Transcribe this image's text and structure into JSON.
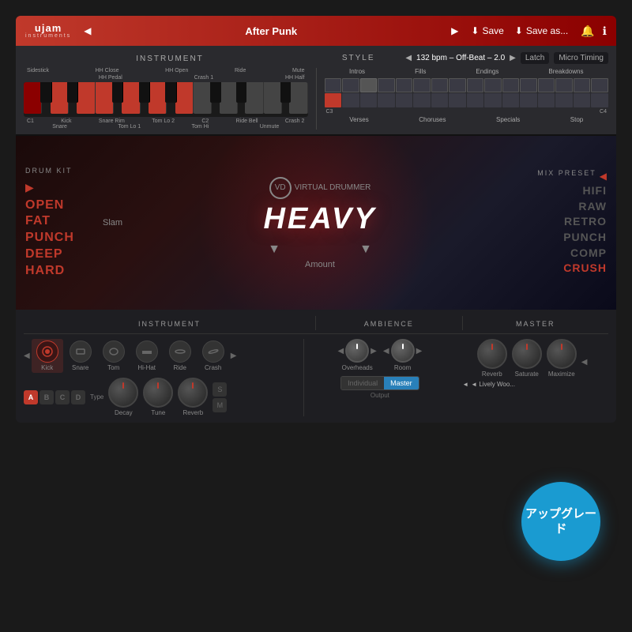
{
  "app": {
    "logo": "ujam",
    "logo_sub": "instruments",
    "preset_name": "After Punk",
    "save_label": "Save",
    "save_as_label": "Save as..."
  },
  "style_bar": {
    "bpm_info": "132 bpm – Off-Beat – 2.0",
    "latch_label": "Latch",
    "micro_timing_label": "Micro Timing"
  },
  "instrument_section": {
    "title": "INSTRUMENT",
    "labels_top": [
      "HH Close",
      "HH Open",
      "Ride",
      "",
      "Mute"
    ],
    "labels_top2": [
      "HH Pedal",
      "Crash 1",
      "HH Half"
    ],
    "labels_bottom": [
      "Kick",
      "Snare Rim",
      "Tom Lo 2",
      "",
      "Ride Bell",
      "Crash 2"
    ],
    "labels_bottom2": [
      "Snare",
      "Tom Lo 1",
      "Tom Hi",
      "",
      "Unmute"
    ],
    "c1_label": "C1",
    "c2_label": "C2",
    "sidestick_label": "Sidestick"
  },
  "style_section": {
    "title": "STYLE",
    "categories_top": [
      "Intros",
      "Fills",
      "Endings",
      "Breakdowns"
    ],
    "categories_bottom": [
      "Verses",
      "Choruses",
      "Specials",
      "Stop"
    ],
    "c3_label": "C3",
    "c4_label": "C4"
  },
  "drum_kit": {
    "label": "DRUM KIT",
    "items": [
      "OPEN",
      "FAT",
      "PUNCH",
      "DEEP",
      "HARD"
    ],
    "slam_label": "Slam"
  },
  "virtual_drummer": {
    "label": "VIRTUAL DRUMMER",
    "title": "HEAVY",
    "amount_label": "Amount"
  },
  "mix_preset": {
    "label": "MIX PRESET",
    "items": [
      "HIFI",
      "RAW",
      "RETRO",
      "PUNCH",
      "COMP",
      "CRUSH"
    ]
  },
  "instrument_controls": {
    "title": "INSTRUMENT",
    "items": [
      {
        "name": "Kick",
        "active": true
      },
      {
        "name": "Snare",
        "active": false
      },
      {
        "name": "Tom",
        "active": false
      },
      {
        "name": "Hi-Hat",
        "active": false
      },
      {
        "name": "Ride",
        "active": false
      },
      {
        "name": "Crash",
        "active": false
      }
    ],
    "type_label": "Type",
    "decay_label": "Decay",
    "tune_label": "Tune",
    "reverb_label": "Reverb",
    "abcd_buttons": [
      "A",
      "B",
      "C",
      "D"
    ],
    "sm_buttons": [
      "S",
      "M"
    ]
  },
  "ambience_controls": {
    "title": "AMBIENCE",
    "items": [
      {
        "name": "Overheads"
      },
      {
        "name": "Room"
      }
    ],
    "output_label": "Output",
    "individual_label": "Individual",
    "master_label": "Master"
  },
  "master_controls": {
    "title": "MASTER",
    "items": [
      {
        "name": "Reverb"
      },
      {
        "name": "Saturate"
      },
      {
        "name": "Maximize"
      }
    ],
    "lively_label": "◄ Lively Woo..."
  },
  "upgrade_badge": {
    "label": "アップグレード"
  }
}
